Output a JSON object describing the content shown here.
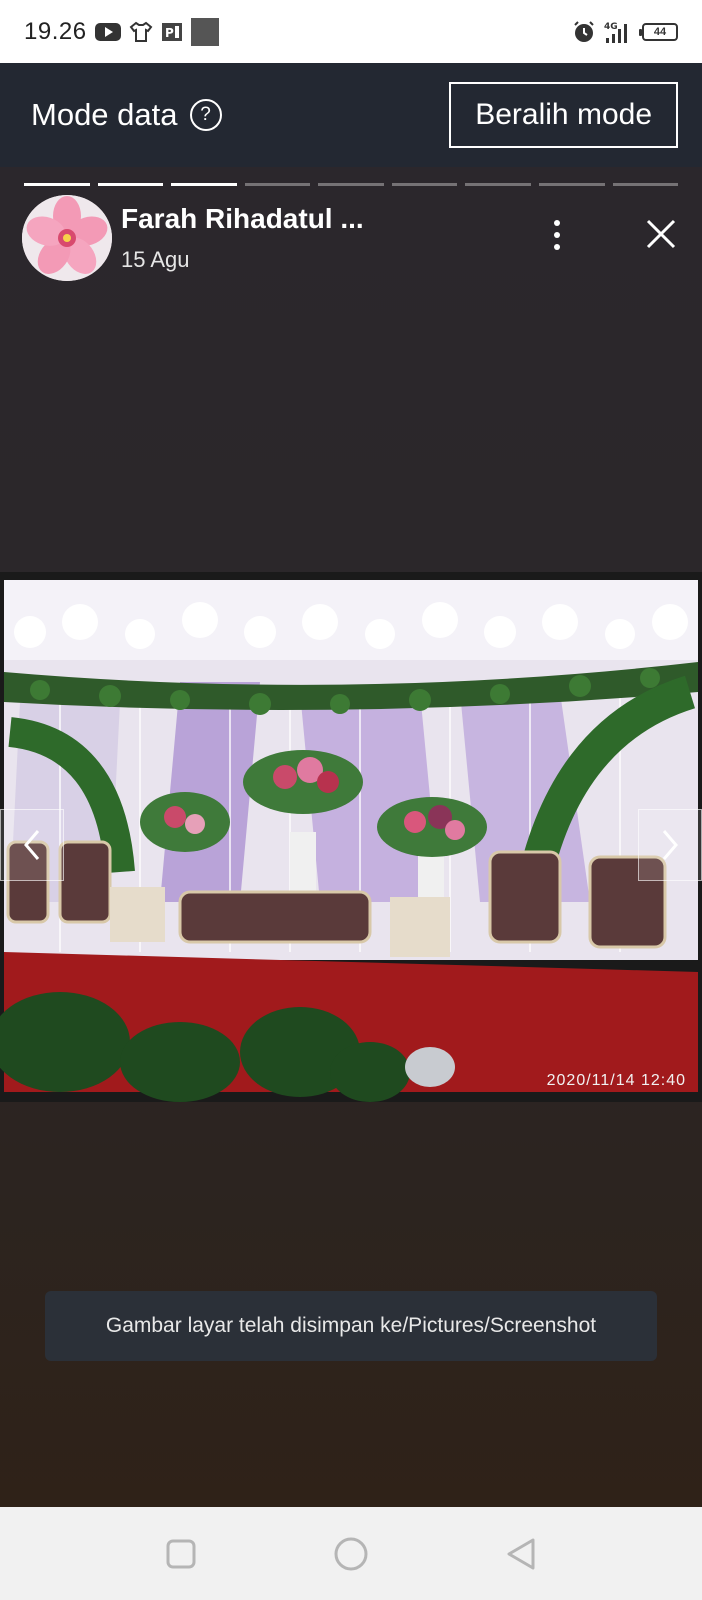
{
  "status_bar": {
    "time": "19.26",
    "icons": [
      "youtube-icon",
      "shirt-icon",
      "pdf-icon",
      "square-icon",
      "alarm-icon",
      "signal-4g-icon",
      "battery-icon"
    ],
    "network": "4G",
    "battery_level": "44"
  },
  "mode_header": {
    "title": "Mode data",
    "help_icon": "?",
    "switch_label": "Beralih mode"
  },
  "story": {
    "progress_total": 9,
    "progress_done": 3,
    "author_name": "Farah Rihadatul ...",
    "date": "15 Agu",
    "photo_timestamp": "2020/11/14  12:40"
  },
  "toast": {
    "message": "Gambar layar telah disimpan ke/Pictures/Screenshot"
  },
  "colors": {
    "header_bg": "#232832",
    "story_bg": "#2b272c",
    "toast_bg": "#2b3038",
    "navbar_bg": "#f1f1f1"
  }
}
